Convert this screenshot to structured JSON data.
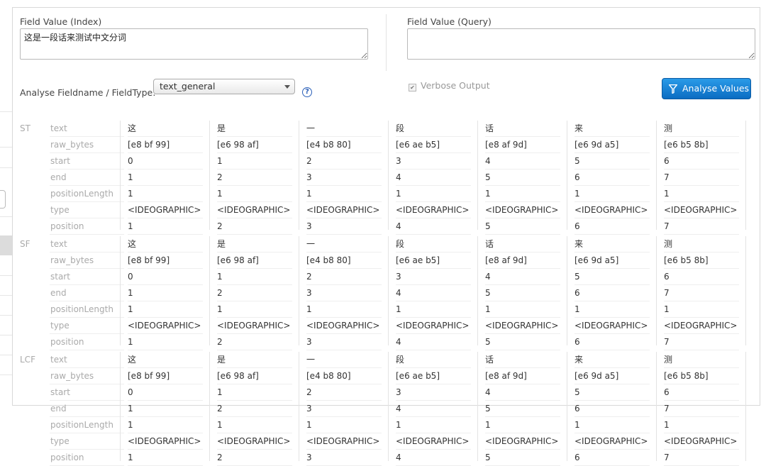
{
  "index_label": "Field Value (Index)",
  "index_value": "这是一段话来测试中文分词",
  "query_label": "Field Value (Query)",
  "query_value": "",
  "fieldtype_label": "Analyse Fieldname / FieldType:",
  "fieldtype_selected": "text_general",
  "help_icon": "?",
  "verbose_label": "Verbose Output",
  "verbose_checked": true,
  "analyse_button": "Analyse Values",
  "row_labels": [
    "text",
    "raw_bytes",
    "start",
    "end",
    "positionLength",
    "type",
    "position"
  ],
  "stages": [
    {
      "name": "ST",
      "tokens": [
        [
          "这",
          "[e8 bf 99]",
          "0",
          "1",
          "1",
          "<IDEOGRAPHIC>",
          "1"
        ],
        [
          "是",
          "[e6 98 af]",
          "1",
          "2",
          "1",
          "<IDEOGRAPHIC>",
          "2"
        ],
        [
          "一",
          "[e4 b8 80]",
          "2",
          "3",
          "1",
          "<IDEOGRAPHIC>",
          "3"
        ],
        [
          "段",
          "[e6 ae b5]",
          "3",
          "4",
          "1",
          "<IDEOGRAPHIC>",
          "4"
        ],
        [
          "话",
          "[e8 af 9d]",
          "4",
          "5",
          "1",
          "<IDEOGRAPHIC>",
          "5"
        ],
        [
          "来",
          "[e6 9d a5]",
          "5",
          "6",
          "1",
          "<IDEOGRAPHIC>",
          "6"
        ],
        [
          "测",
          "[e6 b5 8b]",
          "6",
          "7",
          "1",
          "<IDEOGRAPHIC>",
          "7"
        ]
      ]
    },
    {
      "name": "SF",
      "tokens": [
        [
          "这",
          "[e8 bf 99]",
          "0",
          "1",
          "1",
          "<IDEOGRAPHIC>",
          "1"
        ],
        [
          "是",
          "[e6 98 af]",
          "1",
          "2",
          "1",
          "<IDEOGRAPHIC>",
          "2"
        ],
        [
          "一",
          "[e4 b8 80]",
          "2",
          "3",
          "1",
          "<IDEOGRAPHIC>",
          "3"
        ],
        [
          "段",
          "[e6 ae b5]",
          "3",
          "4",
          "1",
          "<IDEOGRAPHIC>",
          "4"
        ],
        [
          "话",
          "[e8 af 9d]",
          "4",
          "5",
          "1",
          "<IDEOGRAPHIC>",
          "5"
        ],
        [
          "来",
          "[e6 9d a5]",
          "5",
          "6",
          "1",
          "<IDEOGRAPHIC>",
          "6"
        ],
        [
          "测",
          "[e6 b5 8b]",
          "6",
          "7",
          "1",
          "<IDEOGRAPHIC>",
          "7"
        ]
      ]
    },
    {
      "name": "LCF",
      "tokens": [
        [
          "这",
          "[e8 bf 99]",
          "0",
          "1",
          "1",
          "<IDEOGRAPHIC>",
          "1"
        ],
        [
          "是",
          "[e6 98 af]",
          "1",
          "2",
          "1",
          "<IDEOGRAPHIC>",
          "2"
        ],
        [
          "一",
          "[e4 b8 80]",
          "2",
          "3",
          "1",
          "<IDEOGRAPHIC>",
          "3"
        ],
        [
          "段",
          "[e6 ae b5]",
          "3",
          "4",
          "1",
          "<IDEOGRAPHIC>",
          "4"
        ],
        [
          "话",
          "[e8 af 9d]",
          "4",
          "5",
          "1",
          "<IDEOGRAPHIC>",
          "5"
        ],
        [
          "来",
          "[e6 9d a5]",
          "5",
          "6",
          "1",
          "<IDEOGRAPHIC>",
          "6"
        ],
        [
          "测",
          "[e6 b5 8b]",
          "6",
          "7",
          "1",
          "<IDEOGRAPHIC>",
          "7"
        ]
      ]
    }
  ]
}
